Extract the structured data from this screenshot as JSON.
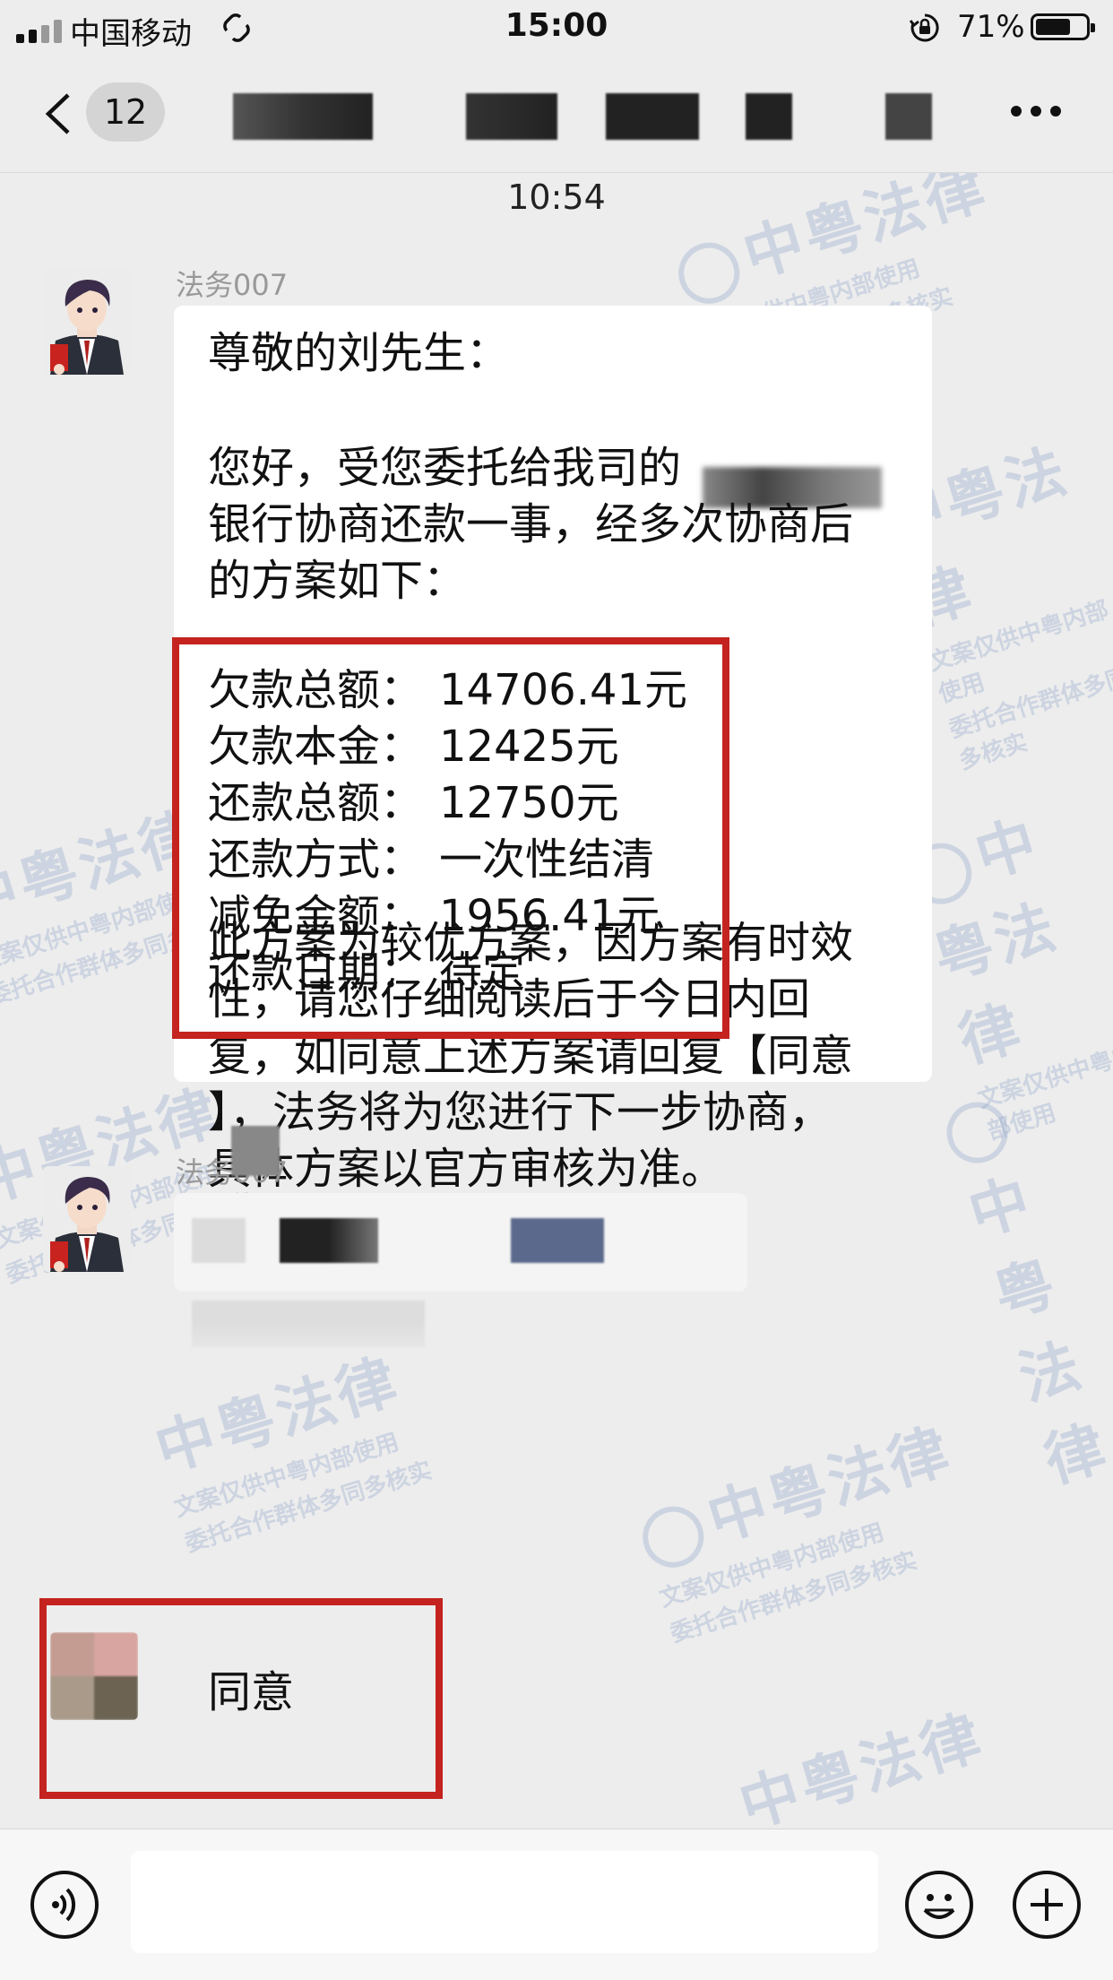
{
  "status_bar": {
    "carrier": "中国移动",
    "time": "15:00",
    "battery": "71%",
    "battery_level": 0.71
  },
  "nav": {
    "unread_count": "12",
    "more_icon": "more-icon",
    "back_icon": "chevron-left-icon"
  },
  "chat": {
    "timestamp": "10:54",
    "watermark_text": "中粤法律",
    "watermark_sub1": "文案仅供中粤内部使用",
    "watermark_sub2": "委托合作群体多同多核实",
    "messages": [
      {
        "sender": "法务007",
        "greeting": "尊敬的刘先生：",
        "intro_line1": "您好，受您委托给我司的",
        "intro_line2": "银行协商还款一事，经多次协商后",
        "intro_line3": "的方案如下：",
        "details": [
          {
            "key": "欠款总额：",
            "value": "14706.41元"
          },
          {
            "key": "欠款本金：",
            "value": "12425元"
          },
          {
            "key": "还款总额：",
            "value": "12750元"
          },
          {
            "key": "还款方式：",
            "value": "一次性结清"
          },
          {
            "key": "减免金额：",
            "value": "1956.41元"
          },
          {
            "key": "还款日期：",
            "value": "待定"
          }
        ],
        "closing_line1": "此方案为较优方案，因方案有时效",
        "closing_line2": "性，请您仔细阅读后于今日内回",
        "closing_line3": "复，如同意上述方案请回复【同意",
        "closing_line4": "】，法务将为您进行下一步协商，",
        "closing_line5": "具体方案以官方审核为准。"
      },
      {
        "sender": "法务007"
      },
      {
        "reply": "同意"
      }
    ]
  },
  "input_bar": {
    "voice_icon": "voice-icon",
    "emoji_icon": "emoji-icon",
    "plus_icon": "plus-icon"
  },
  "colors": {
    "highlight_red": "#c4231f",
    "background": "#ededed",
    "bubble": "#ffffff"
  }
}
